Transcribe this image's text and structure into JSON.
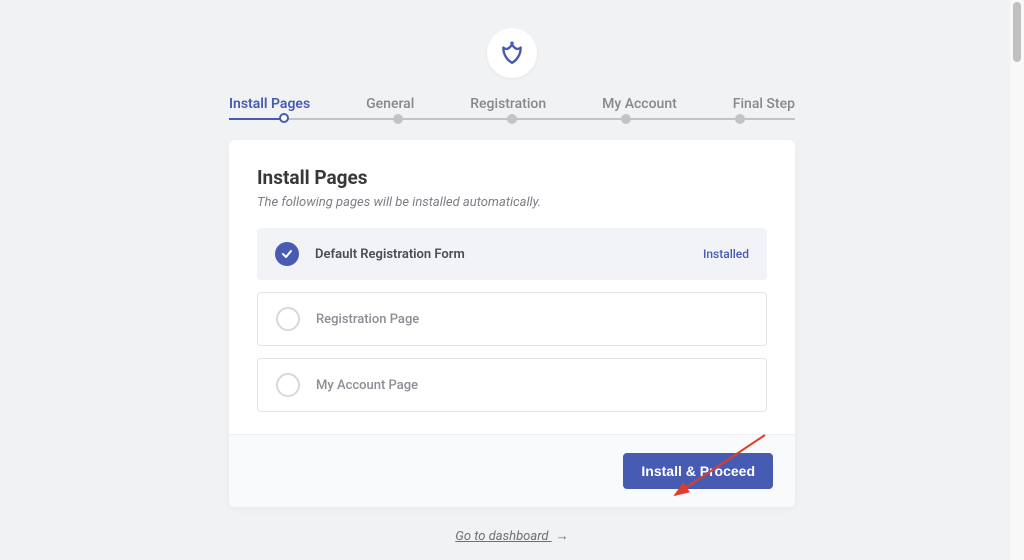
{
  "steps": [
    {
      "label": "Install Pages",
      "active": true
    },
    {
      "label": "General",
      "active": false
    },
    {
      "label": "Registration",
      "active": false
    },
    {
      "label": "My Account",
      "active": false
    },
    {
      "label": "Final Step",
      "active": false
    }
  ],
  "card": {
    "title": "Install Pages",
    "subtitle": "The following pages will be installed automatically.",
    "items": [
      {
        "label": "Default Registration Form",
        "status": "Installed",
        "installed": true
      },
      {
        "label": "Registration Page",
        "status": "",
        "installed": false
      },
      {
        "label": "My Account Page",
        "status": "",
        "installed": false
      }
    ]
  },
  "footer": {
    "primary_button": "Install & Proceed"
  },
  "dashboard_link": "Go to dashboard",
  "dashboard_arrow": "→",
  "colors": {
    "accent": "#475bb2",
    "annotation": "#e13b2a"
  }
}
